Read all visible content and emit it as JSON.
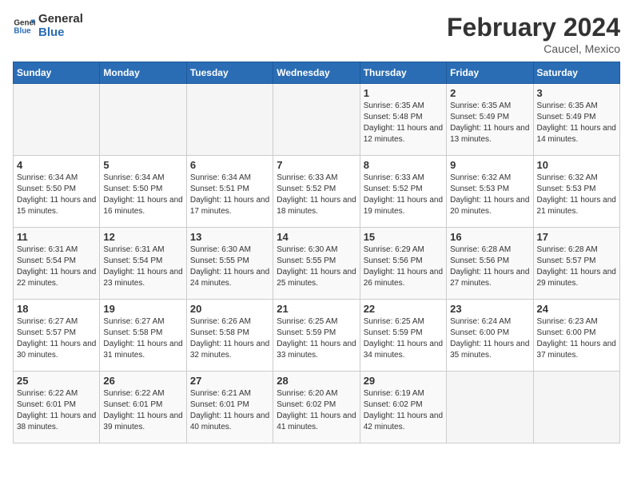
{
  "header": {
    "logo_general": "General",
    "logo_blue": "Blue",
    "title": "February 2024",
    "subtitle": "Caucel, Mexico"
  },
  "days_of_week": [
    "Sunday",
    "Monday",
    "Tuesday",
    "Wednesday",
    "Thursday",
    "Friday",
    "Saturday"
  ],
  "weeks": [
    [
      {
        "day": "",
        "sunrise": "",
        "sunset": "",
        "daylight": ""
      },
      {
        "day": "",
        "sunrise": "",
        "sunset": "",
        "daylight": ""
      },
      {
        "day": "",
        "sunrise": "",
        "sunset": "",
        "daylight": ""
      },
      {
        "day": "",
        "sunrise": "",
        "sunset": "",
        "daylight": ""
      },
      {
        "day": "1",
        "sunrise": "Sunrise: 6:35 AM",
        "sunset": "Sunset: 5:48 PM",
        "daylight": "Daylight: 11 hours and 12 minutes."
      },
      {
        "day": "2",
        "sunrise": "Sunrise: 6:35 AM",
        "sunset": "Sunset: 5:49 PM",
        "daylight": "Daylight: 11 hours and 13 minutes."
      },
      {
        "day": "3",
        "sunrise": "Sunrise: 6:35 AM",
        "sunset": "Sunset: 5:49 PM",
        "daylight": "Daylight: 11 hours and 14 minutes."
      }
    ],
    [
      {
        "day": "4",
        "sunrise": "Sunrise: 6:34 AM",
        "sunset": "Sunset: 5:50 PM",
        "daylight": "Daylight: 11 hours and 15 minutes."
      },
      {
        "day": "5",
        "sunrise": "Sunrise: 6:34 AM",
        "sunset": "Sunset: 5:50 PM",
        "daylight": "Daylight: 11 hours and 16 minutes."
      },
      {
        "day": "6",
        "sunrise": "Sunrise: 6:34 AM",
        "sunset": "Sunset: 5:51 PM",
        "daylight": "Daylight: 11 hours and 17 minutes."
      },
      {
        "day": "7",
        "sunrise": "Sunrise: 6:33 AM",
        "sunset": "Sunset: 5:52 PM",
        "daylight": "Daylight: 11 hours and 18 minutes."
      },
      {
        "day": "8",
        "sunrise": "Sunrise: 6:33 AM",
        "sunset": "Sunset: 5:52 PM",
        "daylight": "Daylight: 11 hours and 19 minutes."
      },
      {
        "day": "9",
        "sunrise": "Sunrise: 6:32 AM",
        "sunset": "Sunset: 5:53 PM",
        "daylight": "Daylight: 11 hours and 20 minutes."
      },
      {
        "day": "10",
        "sunrise": "Sunrise: 6:32 AM",
        "sunset": "Sunset: 5:53 PM",
        "daylight": "Daylight: 11 hours and 21 minutes."
      }
    ],
    [
      {
        "day": "11",
        "sunrise": "Sunrise: 6:31 AM",
        "sunset": "Sunset: 5:54 PM",
        "daylight": "Daylight: 11 hours and 22 minutes."
      },
      {
        "day": "12",
        "sunrise": "Sunrise: 6:31 AM",
        "sunset": "Sunset: 5:54 PM",
        "daylight": "Daylight: 11 hours and 23 minutes."
      },
      {
        "day": "13",
        "sunrise": "Sunrise: 6:30 AM",
        "sunset": "Sunset: 5:55 PM",
        "daylight": "Daylight: 11 hours and 24 minutes."
      },
      {
        "day": "14",
        "sunrise": "Sunrise: 6:30 AM",
        "sunset": "Sunset: 5:55 PM",
        "daylight": "Daylight: 11 hours and 25 minutes."
      },
      {
        "day": "15",
        "sunrise": "Sunrise: 6:29 AM",
        "sunset": "Sunset: 5:56 PM",
        "daylight": "Daylight: 11 hours and 26 minutes."
      },
      {
        "day": "16",
        "sunrise": "Sunrise: 6:28 AM",
        "sunset": "Sunset: 5:56 PM",
        "daylight": "Daylight: 11 hours and 27 minutes."
      },
      {
        "day": "17",
        "sunrise": "Sunrise: 6:28 AM",
        "sunset": "Sunset: 5:57 PM",
        "daylight": "Daylight: 11 hours and 29 minutes."
      }
    ],
    [
      {
        "day": "18",
        "sunrise": "Sunrise: 6:27 AM",
        "sunset": "Sunset: 5:57 PM",
        "daylight": "Daylight: 11 hours and 30 minutes."
      },
      {
        "day": "19",
        "sunrise": "Sunrise: 6:27 AM",
        "sunset": "Sunset: 5:58 PM",
        "daylight": "Daylight: 11 hours and 31 minutes."
      },
      {
        "day": "20",
        "sunrise": "Sunrise: 6:26 AM",
        "sunset": "Sunset: 5:58 PM",
        "daylight": "Daylight: 11 hours and 32 minutes."
      },
      {
        "day": "21",
        "sunrise": "Sunrise: 6:25 AM",
        "sunset": "Sunset: 5:59 PM",
        "daylight": "Daylight: 11 hours and 33 minutes."
      },
      {
        "day": "22",
        "sunrise": "Sunrise: 6:25 AM",
        "sunset": "Sunset: 5:59 PM",
        "daylight": "Daylight: 11 hours and 34 minutes."
      },
      {
        "day": "23",
        "sunrise": "Sunrise: 6:24 AM",
        "sunset": "Sunset: 6:00 PM",
        "daylight": "Daylight: 11 hours and 35 minutes."
      },
      {
        "day": "24",
        "sunrise": "Sunrise: 6:23 AM",
        "sunset": "Sunset: 6:00 PM",
        "daylight": "Daylight: 11 hours and 37 minutes."
      }
    ],
    [
      {
        "day": "25",
        "sunrise": "Sunrise: 6:22 AM",
        "sunset": "Sunset: 6:01 PM",
        "daylight": "Daylight: 11 hours and 38 minutes."
      },
      {
        "day": "26",
        "sunrise": "Sunrise: 6:22 AM",
        "sunset": "Sunset: 6:01 PM",
        "daylight": "Daylight: 11 hours and 39 minutes."
      },
      {
        "day": "27",
        "sunrise": "Sunrise: 6:21 AM",
        "sunset": "Sunset: 6:01 PM",
        "daylight": "Daylight: 11 hours and 40 minutes."
      },
      {
        "day": "28",
        "sunrise": "Sunrise: 6:20 AM",
        "sunset": "Sunset: 6:02 PM",
        "daylight": "Daylight: 11 hours and 41 minutes."
      },
      {
        "day": "29",
        "sunrise": "Sunrise: 6:19 AM",
        "sunset": "Sunset: 6:02 PM",
        "daylight": "Daylight: 11 hours and 42 minutes."
      },
      {
        "day": "",
        "sunrise": "",
        "sunset": "",
        "daylight": ""
      },
      {
        "day": "",
        "sunrise": "",
        "sunset": "",
        "daylight": ""
      }
    ]
  ]
}
